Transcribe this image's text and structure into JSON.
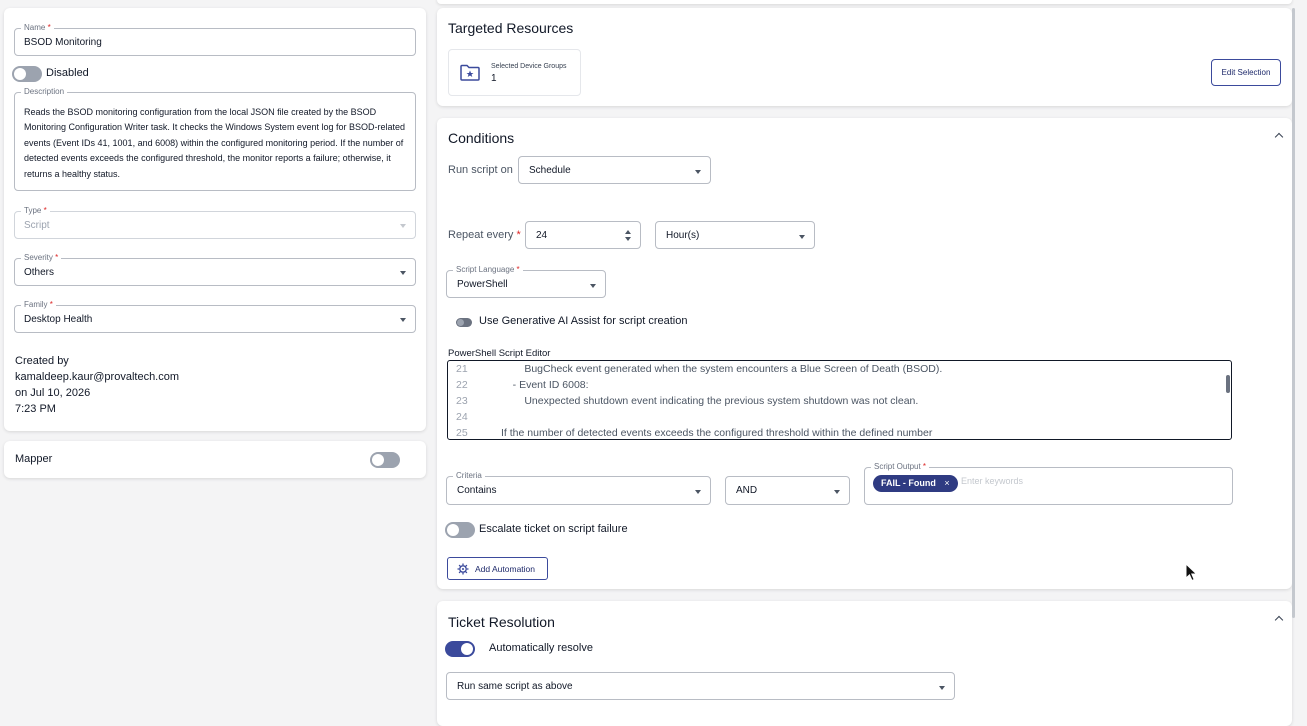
{
  "left": {
    "name": {
      "label": "Name",
      "value": "BSOD Monitoring"
    },
    "status_toggle": {
      "label": "Disabled"
    },
    "description": {
      "label": "Description",
      "value": "Reads the BSOD monitoring configuration from the local JSON file created by the BSOD Monitoring Configuration Writer task. It checks the Windows System event log for BSOD-related events (Event IDs 41, 1001, and 6008) within the configured monitoring period. If the number of detected events exceeds the configured threshold, the monitor reports a failure; otherwise, it returns a healthy status."
    },
    "type": {
      "label": "Type",
      "value": "Script"
    },
    "severity": {
      "label": "Severity",
      "value": "Others"
    },
    "family": {
      "label": "Family",
      "value": "Desktop Health"
    },
    "created": {
      "line1": "Created by",
      "line2": "kamaldeep.kaur@provaltech.com",
      "line3": "on Jul 10, 2026",
      "line4": "7:23 PM"
    },
    "mapper": {
      "label": "Mapper"
    }
  },
  "targeted": {
    "title": "Targeted Resources",
    "tile_label": "Selected Device Groups",
    "tile_count": "1",
    "edit_label": "Edit Selection"
  },
  "conditions": {
    "title": "Conditions",
    "run_on_label": "Run script on",
    "run_on_value": "Schedule",
    "repeat_label": "Repeat every",
    "repeat_value": "24",
    "repeat_unit": "Hour(s)",
    "lang_label": "Script Language",
    "lang_value": "PowerShell",
    "ai_assist_label": "Use Generative AI Assist for script creation",
    "editor_label": "PowerShell Script Editor",
    "code": [
      {
        "n": "21",
        "t": "        BugCheck event generated when the system encounters a Blue Screen of Death (BSOD)."
      },
      {
        "n": "22",
        "t": "    - Event ID 6008:"
      },
      {
        "n": "23",
        "t": "        Unexpected shutdown event indicating the previous system shutdown was not clean."
      },
      {
        "n": "24",
        "t": ""
      },
      {
        "n": "25",
        "t": "If the number of detected events exceeds the configured threshold within the defined number"
      }
    ],
    "criteria_label": "Criteria",
    "criteria_value": "Contains",
    "logic_value": "AND",
    "output_label": "Script Output",
    "output_chip": "FAIL - Found",
    "output_placeholder": "Enter keywords",
    "escalate_label": "Escalate ticket on script failure",
    "add_automation_label": "Add Automation"
  },
  "resolution": {
    "title": "Ticket Resolution",
    "auto_label": "Automatically resolve",
    "method_value": "Run same script as above"
  },
  "colors": {
    "accent": "#3b4a9c",
    "chip": "#2f3b82",
    "border": "#b8bcc4"
  }
}
